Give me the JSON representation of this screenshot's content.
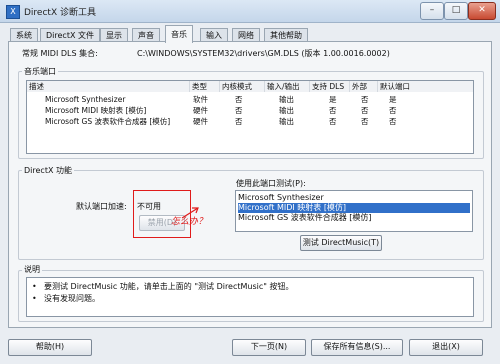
{
  "window": {
    "title": "DirectX 诊断工具",
    "icon_name": "directx-icon",
    "buttons": [
      "–",
      "□",
      "✕"
    ]
  },
  "tabs": [
    {
      "label": "系统"
    },
    {
      "label": "DirectX 文件"
    },
    {
      "label": "显示"
    },
    {
      "label": "声音"
    },
    {
      "label": "音乐"
    },
    {
      "label": "输入"
    },
    {
      "label": "网络"
    },
    {
      "label": "其他帮助"
    }
  ],
  "active_tab": "音乐",
  "dls": {
    "label": "常规 MIDI DLS 集合:",
    "value": "C:\\WINDOWS\\SYSTEM32\\drivers\\GM.DLS (版本 1.00.0016.0002)"
  },
  "ports": {
    "title": "音乐端口",
    "columns": [
      "描述",
      "类型",
      "内核模式",
      "输入/输出",
      "支持 DLS",
      "外部",
      "默认端口"
    ],
    "rows": [
      [
        "Microsoft Synthesizer",
        "软件",
        "否",
        "输出",
        "是",
        "否",
        "是"
      ],
      [
        "Microsoft MIDI 映射表 [模仿]",
        "硬件",
        "否",
        "输出",
        "否",
        "否",
        "否"
      ],
      [
        "Microsoft GS 波表软件合成器 [模仿]",
        "硬件",
        "否",
        "输出",
        "否",
        "否",
        "否"
      ]
    ]
  },
  "features": {
    "title": "DirectX 功能",
    "accel_label": "默认端口加速:",
    "accel_value": "不可用",
    "disable_button": "禁用(D)",
    "annotation": "怎么办？",
    "test_port_label": "使用此端口测试(P):",
    "test_ports": [
      "Microsoft Synthesizer",
      "Microsoft MIDI 映射表 [模仿]",
      "Microsoft GS 波表软件合成器 [模仿]"
    ],
    "selected_index": 1,
    "test_button": "测试 DirectMusic(T)"
  },
  "notes": {
    "title": "说明",
    "items": [
      "要测试 DirectMusic 功能，请单击上面的 \"测试 DirectMusic\" 按钮。",
      "没有发现问题。"
    ]
  },
  "footer": {
    "help": "帮助(H)",
    "next": "下一页(N)",
    "save": "保存所有信息(S)...",
    "exit": "退出(X)"
  },
  "colors": {
    "selection": "#3170c9",
    "annotation": "#e01b1b"
  }
}
